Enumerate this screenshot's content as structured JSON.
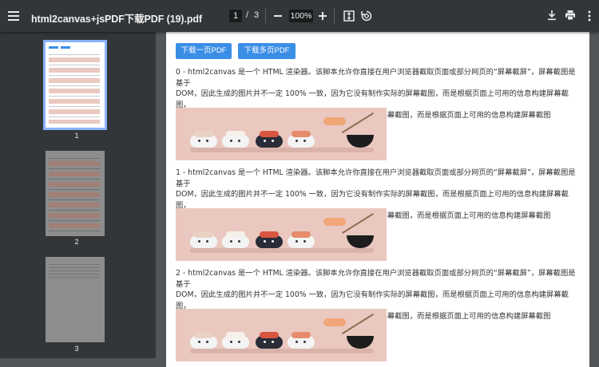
{
  "toolbar": {
    "title": "html2canvas+jsPDF下载PDF (19).pdf",
    "current_page": "1",
    "page_sep": "/",
    "total_pages": "3",
    "zoom": "100%"
  },
  "thumbnails": [
    {
      "number": "1"
    },
    {
      "number": "2"
    },
    {
      "number": "3"
    }
  ],
  "page": {
    "buttons": {
      "single": "下载一页PDF",
      "multi": "下载多页PDF"
    },
    "paragraphs": [
      {
        "line1": "0 - html2canvas 是一个 HTML 渲染器。该脚本允许你直接在用户浏览器截取页面或部分网页的“屏幕截屏”，屏幕截图是基于",
        "line2": "DOM，因此生成的图片并不一定 100% 一致，因为它没有制作实际的屏幕截图，而是根据页面上可用的信息构建屏幕截图，",
        "line3": "因此生成的图片并不一定 100% 一致，因为它没有制作实际的屏幕截图，而是根据页面上可用的信息构建屏幕截图"
      },
      {
        "line1": "1 - html2canvas 是一个 HTML 渲染器。该脚本允许你直接在用户浏览器截取页面或部分网页的“屏幕截屏”，屏幕截图是基于",
        "line2": "DOM，因此生成的图片并不一定 100% 一致，因为它没有制作实际的屏幕截图，而是根据页面上可用的信息构建屏幕截图，",
        "line3": "因此生成的图片并不一定 100% 一致，因为它没有制作实际的屏幕截图，而是根据页面上可用的信息构建屏幕截图"
      },
      {
        "line1": "2 - html2canvas 是一个 HTML 渲染器。该脚本允许你直接在用户浏览器截取页面或部分网页的“屏幕截屏”，屏幕截图是基于",
        "line2": "DOM，因此生成的图片并不一定 100% 一致，因为它没有制作实际的屏幕截图，而是根据页面上可用的信息构建屏幕截图，",
        "line3": "因此生成的图片并不一定 100% 一致，因为它没有制作实际的屏幕截图，而是根据页面上可用的信息构建屏幕截图"
      }
    ]
  },
  "icons": {
    "menu": "menu-icon",
    "zoom_out": "minus-icon",
    "zoom_in": "plus-icon",
    "fit": "fit-page-icon",
    "rotate": "rotate-icon",
    "download": "download-icon",
    "print": "print-icon",
    "more": "more-vert-icon"
  },
  "colors": {
    "toolbar_bg": "#323639",
    "viewer_bg": "#525659",
    "button_blue": "#3a8ee6",
    "thumb_highlight": "#8ab4f8"
  }
}
